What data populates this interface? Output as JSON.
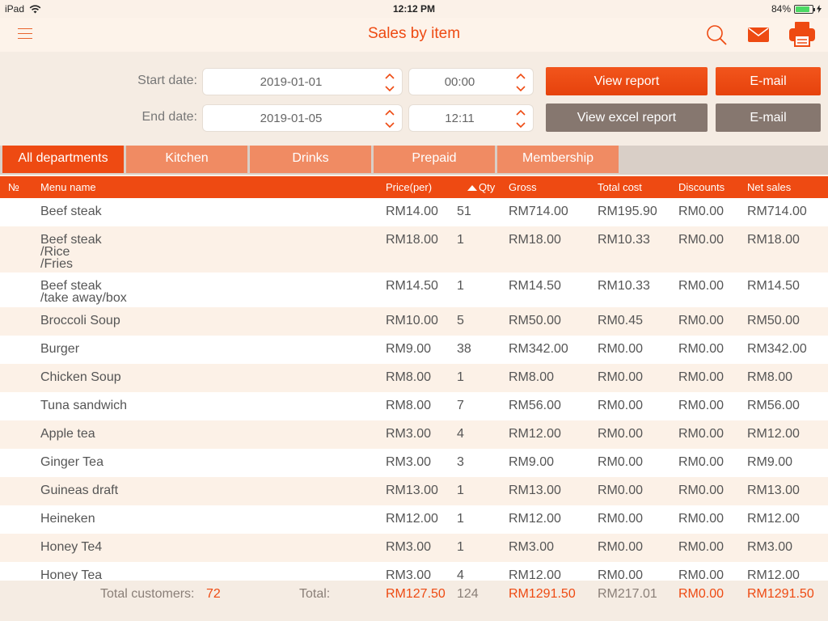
{
  "status": {
    "device": "iPad",
    "time": "12:12 PM",
    "battery": "84%",
    "battery_level": 0.84
  },
  "nav": {
    "title": "Sales by item",
    "icons": [
      "menu-icon",
      "search-icon",
      "mail-icon",
      "printer-icon"
    ]
  },
  "filters": {
    "start_label": "Start date:",
    "end_label": "End date:",
    "start_date": "2019-01-01",
    "start_time": "00:00",
    "end_date": "2019-01-05",
    "end_time": "12:11",
    "view_report": "View report",
    "view_excel": "View excel report",
    "email": "E-mail",
    "email2": "E-mail"
  },
  "tabs": [
    {
      "label": "All departments",
      "active": true
    },
    {
      "label": "Kitchen"
    },
    {
      "label": "Drinks"
    },
    {
      "label": "Prepaid"
    },
    {
      "label": "Membership"
    }
  ],
  "columns": {
    "no": "№",
    "name": "Menu name",
    "price": "Price(per)",
    "qty": "Qty",
    "gross": "Gross",
    "cost": "Total cost",
    "discounts": "Discounts",
    "net": "Net sales"
  },
  "rows": [
    {
      "name": "Beef steak",
      "price": "RM14.00",
      "qty": "51",
      "gross": "RM714.00",
      "cost": "RM195.90",
      "disc": "RM0.00",
      "net": "RM714.00"
    },
    {
      "name": "Beef steak\n/Rice\n/Fries",
      "price": "RM18.00",
      "qty": "1",
      "gross": "RM18.00",
      "cost": "RM10.33",
      "disc": "RM0.00",
      "net": "RM18.00"
    },
    {
      "name": "Beef steak\n/take away/box",
      "price": "RM14.50",
      "qty": "1",
      "gross": "RM14.50",
      "cost": "RM10.33",
      "disc": "RM0.00",
      "net": "RM14.50"
    },
    {
      "name": "Broccoli Soup",
      "price": "RM10.00",
      "qty": "5",
      "gross": "RM50.00",
      "cost": "RM0.45",
      "disc": "RM0.00",
      "net": "RM50.00"
    },
    {
      "name": "Burger",
      "price": "RM9.00",
      "qty": "38",
      "gross": "RM342.00",
      "cost": "RM0.00",
      "disc": "RM0.00",
      "net": "RM342.00"
    },
    {
      "name": "Chicken Soup",
      "price": "RM8.00",
      "qty": "1",
      "gross": "RM8.00",
      "cost": "RM0.00",
      "disc": "RM0.00",
      "net": "RM8.00"
    },
    {
      "name": "Tuna sandwich",
      "price": "RM8.00",
      "qty": "7",
      "gross": "RM56.00",
      "cost": "RM0.00",
      "disc": "RM0.00",
      "net": "RM56.00"
    },
    {
      "name": "Apple tea",
      "price": "RM3.00",
      "qty": "4",
      "gross": "RM12.00",
      "cost": "RM0.00",
      "disc": "RM0.00",
      "net": "RM12.00"
    },
    {
      "name": "Ginger Tea",
      "price": "RM3.00",
      "qty": "3",
      "gross": "RM9.00",
      "cost": "RM0.00",
      "disc": "RM0.00",
      "net": "RM9.00"
    },
    {
      "name": "Guineas draft",
      "price": "RM13.00",
      "qty": "1",
      "gross": "RM13.00",
      "cost": "RM0.00",
      "disc": "RM0.00",
      "net": "RM13.00"
    },
    {
      "name": "Heineken",
      "price": "RM12.00",
      "qty": "1",
      "gross": "RM12.00",
      "cost": "RM0.00",
      "disc": "RM0.00",
      "net": "RM12.00"
    },
    {
      "name": "Honey Te4",
      "price": "RM3.00",
      "qty": "1",
      "gross": "RM3.00",
      "cost": "RM0.00",
      "disc": "RM0.00",
      "net": "RM3.00"
    },
    {
      "name": "Honey Tea",
      "price": "RM3.00",
      "qty": "4",
      "gross": "RM12.00",
      "cost": "RM0.00",
      "disc": "RM0.00",
      "net": "RM12.00"
    }
  ],
  "footer": {
    "customers_label": "Total customers:",
    "customers": "72",
    "total_label": "Total:",
    "price": "RM127.50",
    "qty": "124",
    "gross": "RM1291.50",
    "cost": "RM217.01",
    "disc": "RM0.00",
    "net": "RM1291.50"
  },
  "colors": {
    "accent": "#ee4a12",
    "tab_inactive": "#f08b63",
    "button_gray": "#86776f",
    "background": "#fbf1e8"
  }
}
